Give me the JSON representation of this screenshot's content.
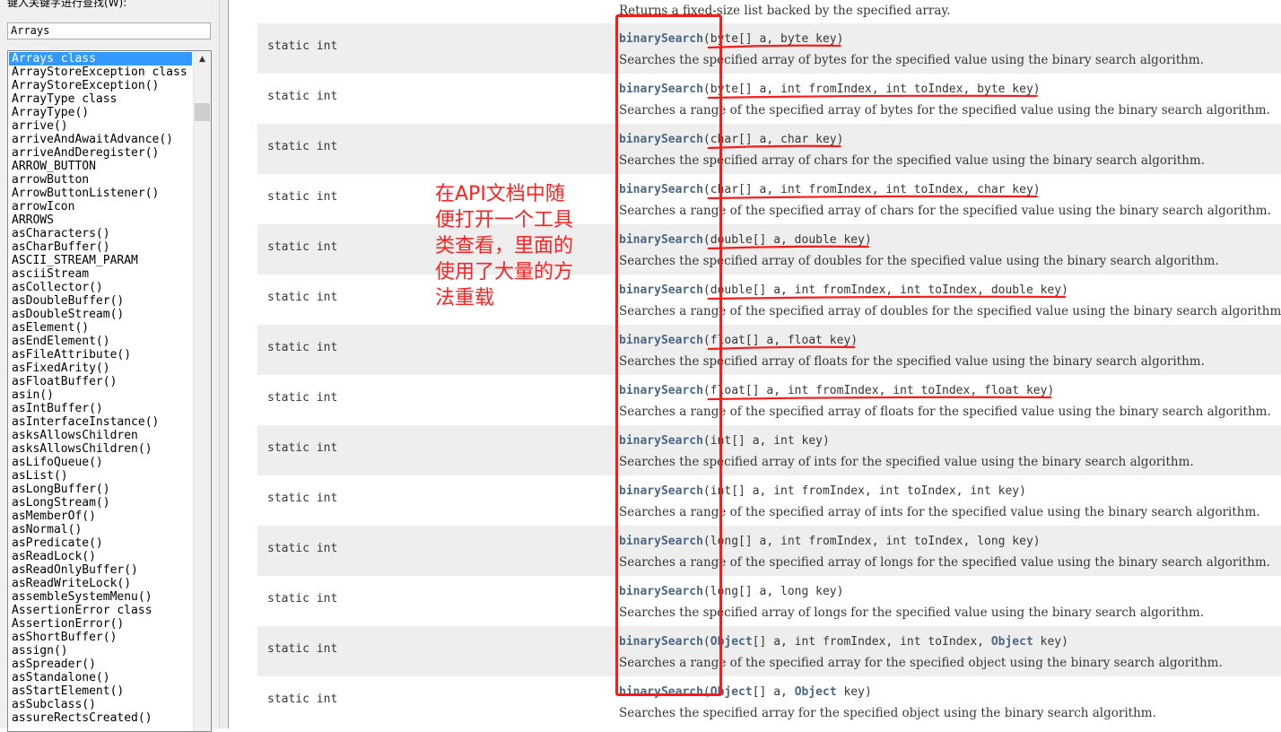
{
  "search": {
    "label": "键入关键字进行查找(W):",
    "value": "Arrays"
  },
  "index_items": [
    "Arrays class",
    "ArrayStoreException class",
    "ArrayStoreException()",
    "ArrayType class",
    "ArrayType()",
    "arrive()",
    "arriveAndAwaitAdvance()",
    "arriveAndDeregister()",
    "ARROW_BUTTON",
    "arrowButton",
    "ArrowButtonListener()",
    "arrowIcon",
    "ARROWS",
    "asCharacters()",
    "asCharBuffer()",
    "ASCII_STREAM_PARAM",
    "asciiStream",
    "asCollector()",
    "asDoubleBuffer()",
    "asDoubleStream()",
    "asElement()",
    "asEndElement()",
    "asFileAttribute()",
    "asFixedArity()",
    "asFloatBuffer()",
    "asin()",
    "asIntBuffer()",
    "asInterfaceInstance()",
    "asksAllowsChildren",
    "asksAllowsChildren()",
    "asLifoQueue()",
    "asList()",
    "asLongBuffer()",
    "asLongStream()",
    "asMemberOf()",
    "asNormal()",
    "asPredicate()",
    "asReadLock()",
    "asReadOnlyBuffer()",
    "asReadWriteLock()",
    "assembleSystemMenu()",
    "AssertionError class",
    "AssertionError()",
    "asShortBuffer()",
    "assign()",
    "asSpreader()",
    "asStandalone()",
    "asStartElement()",
    "asSubclass()",
    "assureRectsCreated()"
  ],
  "selected_index": 0,
  "top_description": "Returns a fixed-size list backed by the specified array.",
  "methods": [
    {
      "modifier": "static int",
      "name": "binarySearch",
      "params": "byte[] a, byte key",
      "param_parts": [
        [
          "byte[] a, byte key",
          false
        ]
      ],
      "desc": "Searches the specified array of bytes for the specified value using the binary search algorithm."
    },
    {
      "modifier": "static int",
      "name": "binarySearch",
      "params": "byte[] a, int fromIndex, int toIndex, byte key",
      "param_parts": [
        [
          "byte[] a, int fromIndex, int toIndex, byte key",
          false
        ]
      ],
      "desc": "Searches a range of the specified array of bytes for the specified value using the binary search algorithm."
    },
    {
      "modifier": "static int",
      "name": "binarySearch",
      "params": "char[] a, char key",
      "param_parts": [
        [
          "char[] a, char key",
          false
        ]
      ],
      "desc": "Searches the specified array of chars for the specified value using the binary search algorithm."
    },
    {
      "modifier": "static int",
      "name": "binarySearch",
      "params": "char[] a, int fromIndex, int toIndex, char key",
      "param_parts": [
        [
          "char[] a, int fromIndex, int toIndex, char key",
          false
        ]
      ],
      "desc": "Searches a range of the specified array of chars for the specified value using the binary search algorithm."
    },
    {
      "modifier": "static int",
      "name": "binarySearch",
      "params": "double[] a, double key",
      "param_parts": [
        [
          "double[] a, double key",
          false
        ]
      ],
      "desc": "Searches the specified array of doubles for the specified value using the binary search algorithm."
    },
    {
      "modifier": "static int",
      "name": "binarySearch",
      "params": "double[] a, int fromIndex, int toIndex, double key",
      "param_parts": [
        [
          "double[] a, int fromIndex, int toIndex, double key",
          false
        ]
      ],
      "desc": "Searches a range of the specified array of doubles for the specified value using the binary search algorithm."
    },
    {
      "modifier": "static int",
      "name": "binarySearch",
      "params": "float[] a, float key",
      "param_parts": [
        [
          "float[] a, float key",
          false
        ]
      ],
      "desc": "Searches the specified array of floats for the specified value using the binary search algorithm."
    },
    {
      "modifier": "static int",
      "name": "binarySearch",
      "params": "float[] a, int fromIndex, int toIndex, float key",
      "param_parts": [
        [
          "float[] a, int fromIndex, int toIndex, float key",
          false
        ]
      ],
      "desc": "Searches a range of the specified array of floats for the specified value using the binary search algorithm."
    },
    {
      "modifier": "static int",
      "name": "binarySearch",
      "params": "int[] a, int key",
      "param_parts": [
        [
          "int[] a, int key",
          false
        ]
      ],
      "desc": "Searches the specified array of ints for the specified value using the binary search algorithm."
    },
    {
      "modifier": "static int",
      "name": "binarySearch",
      "params": "int[] a, int fromIndex, int toIndex, int key",
      "param_parts": [
        [
          "int[] a, int fromIndex, int toIndex, int key",
          false
        ]
      ],
      "desc": "Searches a range of the specified array of ints for the specified value using the binary search algorithm."
    },
    {
      "modifier": "static int",
      "name": "binarySearch",
      "params": "long[] a, int fromIndex, int toIndex, long key",
      "param_parts": [
        [
          "long[] a, int fromIndex, int toIndex, long key",
          false
        ]
      ],
      "desc": "Searches a range of the specified array of longs for the specified value using the binary search algorithm."
    },
    {
      "modifier": "static int",
      "name": "binarySearch",
      "params": "long[] a, long key",
      "param_parts": [
        [
          "long[] a, long key",
          false
        ]
      ],
      "desc": "Searches the specified array of longs for the specified value using the binary search algorithm."
    },
    {
      "modifier": "static int",
      "name": "binarySearch",
      "params": "Object[] a, int fromIndex, int toIndex, Object key",
      "param_parts": [
        [
          "Object",
          true
        ],
        [
          "[] a, int fromIndex, int toIndex, ",
          false
        ],
        [
          "Object",
          true
        ],
        [
          " key",
          false
        ]
      ],
      "desc": "Searches a range of the specified array for the specified object using the binary search algorithm."
    },
    {
      "modifier": "static int",
      "name": "binarySearch",
      "params": "Object[] a, Object key",
      "param_parts": [
        [
          "Object",
          true
        ],
        [
          "[] a, ",
          false
        ],
        [
          "Object",
          true
        ],
        [
          " key",
          false
        ]
      ],
      "desc": "Searches the specified array for the specified object using the binary search algorithm."
    }
  ],
  "annotation": {
    "note": "在API文档中随便打开一个工具类查看，里面的使用了大量的方法重载",
    "color": "#ff1a1a"
  },
  "colors": {
    "method_link": "#4a6782",
    "text": "#353833",
    "row_alt": "#eeeeef",
    "selection": "#3399ff"
  }
}
